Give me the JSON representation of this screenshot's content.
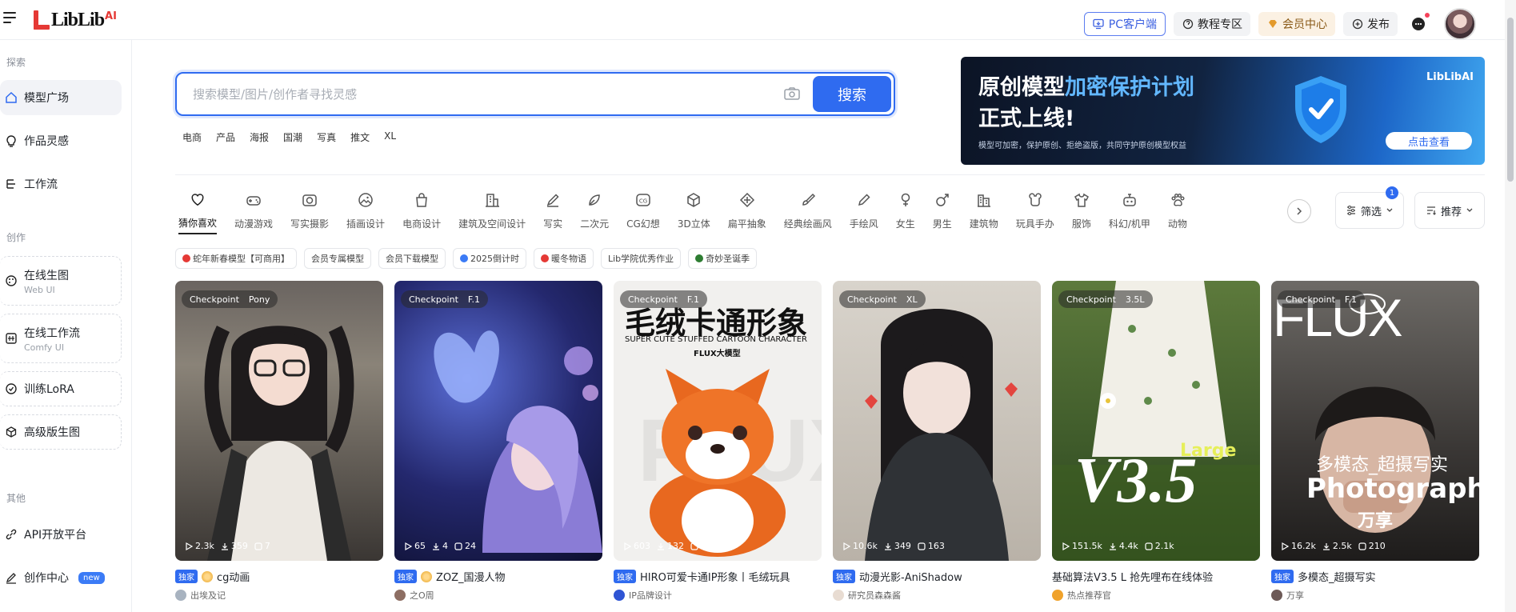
{
  "brand": {
    "logo_text": "LibLib",
    "logo_sup": "AI"
  },
  "header": {
    "pc_client": "PC客户端",
    "tutorial": "教程专区",
    "vip": "会员中心",
    "publish": "发布"
  },
  "sidebar": {
    "section_explore": "探索",
    "section_create": "创作",
    "section_other": "其他",
    "items": [
      {
        "label": "模型广场",
        "icon": "home-icon"
      },
      {
        "label": "作品灵感",
        "icon": "bulb-icon"
      },
      {
        "label": "工作流",
        "icon": "flow-icon"
      },
      {
        "label": "在线生图",
        "sub": "Web UI",
        "icon": "palette-icon"
      },
      {
        "label": "在线工作流",
        "sub": "Comfy UI",
        "icon": "grid-icon"
      },
      {
        "label": "训练LoRA",
        "icon": "shield-icon"
      },
      {
        "label": "高级版生图",
        "icon": "cube-icon"
      },
      {
        "label": "API开放平台",
        "icon": "link-icon"
      },
      {
        "label": "创作中心",
        "badge": "new",
        "icon": "edit-icon"
      }
    ]
  },
  "search": {
    "placeholder": "搜索模型/图片/创作者寻找灵感",
    "button": "搜索",
    "hot_tags": [
      "电商",
      "产品",
      "海报",
      "国潮",
      "写真",
      "推文",
      "XL"
    ]
  },
  "banner": {
    "line1_a": "原创模型",
    "line1_b": "加密保护计划",
    "line2": "正式上线!",
    "desc": "模型可加密，保护原创、拒绝盗版，共同守护原创模型权益",
    "logo": "LibLibAI",
    "cta": "点击查看"
  },
  "categories": [
    "猜你喜欢",
    "动漫游戏",
    "写实摄影",
    "插画设计",
    "电商设计",
    "建筑及空间设计",
    "写实",
    "二次元",
    "CG幻想",
    "3D立体",
    "扁平抽象",
    "经典绘画风",
    "手绘风",
    "女生",
    "男生",
    "建筑物",
    "玩具手办",
    "服饰",
    "科幻/机甲",
    "动物"
  ],
  "filter": {
    "label": "筛选",
    "count": "1"
  },
  "sort": {
    "label": "推荐"
  },
  "chips": [
    {
      "label": "蛇年新春模型【可商用】",
      "color": "#e53935"
    },
    {
      "label": "会员专属模型",
      "color": ""
    },
    {
      "label": "会员下载模型",
      "color": ""
    },
    {
      "label": "2025倒计时",
      "color": "#3b7bf6"
    },
    {
      "label": "暖冬物语",
      "color": "#e53935"
    },
    {
      "label": "Lib学院优秀作业",
      "color": ""
    },
    {
      "label": "奇妙圣诞季",
      "color": "#2e7d32"
    }
  ],
  "cards": [
    {
      "type": "Checkpoint",
      "base": "Pony",
      "runs": "2.3k",
      "downloads": "359",
      "images": "7",
      "exclusive": "独家",
      "title": "cg动画",
      "author": "出埃及记",
      "gold": true
    },
    {
      "type": "Checkpoint",
      "base": "F.1",
      "runs": "65",
      "downloads": "4",
      "images": "24",
      "exclusive": "独家",
      "title": "ZOZ_国漫人物",
      "author": "之O周",
      "gold": true
    },
    {
      "type": "Checkpoint",
      "base": "F.1",
      "runs": "603",
      "downloads": "132",
      "images": "40",
      "exclusive": "独家",
      "title": "HIRO可爱卡通IP形象丨毛绒玩具",
      "author": "IP品牌设计",
      "gold": false,
      "overlay_title": "毛绒卡通形象",
      "overlay_sub": "SUPER CUTE STUFFED CARTOON CHARACTER",
      "overlay_tag": "FLUX大模型"
    },
    {
      "type": "Checkpoint",
      "base": "XL",
      "runs": "10.6k",
      "downloads": "349",
      "images": "163",
      "exclusive": "独家",
      "title": "动漫光影-AniShadow",
      "author": "研究员森森酱",
      "gold": false
    },
    {
      "type": "Checkpoint",
      "base": "3.5L",
      "runs": "151.5k",
      "downloads": "4.4k",
      "images": "2.1k",
      "exclusive": "",
      "title": "基础算法V3.5 L 抢先哩布在线体验",
      "author": "热点推荐官",
      "gold": false,
      "overlay_big": "V3.5",
      "overlay_tag": "Large"
    },
    {
      "type": "Checkpoint",
      "base": "F.1",
      "runs": "16.2k",
      "downloads": "2.5k",
      "images": "210",
      "exclusive": "独家",
      "title": "多模态_超摄写实",
      "author": "万享",
      "gold": false,
      "overlay_big": "FLUX",
      "overlay_sub": "多模态_超摄写实",
      "overlay_tag": "Photography",
      "overlay_small": "万享"
    }
  ]
}
